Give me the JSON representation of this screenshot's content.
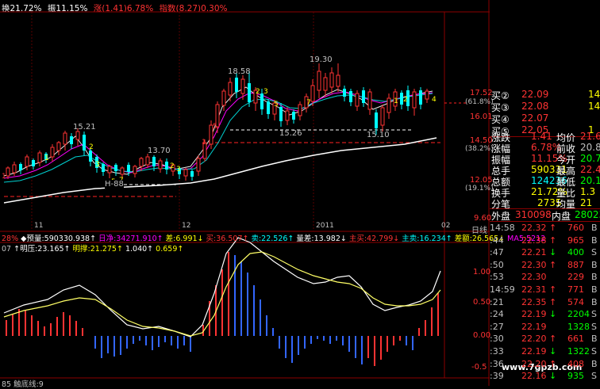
{
  "header": {
    "top_indicators": [
      {
        "text": "换21.72%",
        "color": "#ffffff"
      },
      {
        "text": "振11.15%",
        "color": "#ffffff"
      },
      {
        "text": "涨(1.41)6.78%",
        "color": "#ff3333"
      },
      {
        "text": "指数(8.27)0.30%",
        "color": "#ff3333"
      }
    ]
  },
  "price_chart": {
    "labels": [
      "15.21",
      "13.70",
      "18.58",
      "19.30",
      "15.26",
      "15.10",
      "H-88"
    ],
    "y_axis": [
      "17.52",
      "(61.8%)",
      "16.01",
      "14.50",
      "(38.2%)",
      "12.05",
      "(19.1%)",
      "9.60"
    ],
    "x_axis": [
      "11",
      "12",
      "2011",
      "02"
    ],
    "period_label": "日线"
  },
  "indicator_bar": [
    {
      "text": "28%",
      "color": "#ff3333"
    },
    {
      "text": "◆预量:590330.938↑",
      "color": "#ffffff"
    },
    {
      "text": "日净:34271.910↑",
      "color": "#ff00ff"
    },
    {
      "text": "差:6.991↓",
      "color": "#ffff00"
    },
    {
      "text": "买:36.507↑",
      "color": "#ff3333"
    },
    {
      "text": "卖:22.526↑",
      "color": "#00ffff"
    },
    {
      "text": "量差:13.982↓",
      "color": "#ffffff"
    },
    {
      "text": "主买:42.799↓",
      "color": "#ff3333"
    },
    {
      "text": "主卖:16.234↑",
      "color": "#00ffff"
    },
    {
      "text": "差额:26.565↓",
      "color": "#ffff00"
    },
    {
      "text": "MA5:5212",
      "color": "#ff00ff"
    }
  ],
  "indicator2_bar": [
    {
      "text": "07",
      "color": "#c0c0c0"
    },
    {
      "text": "↑明压:23.165↑",
      "color": "#ffffff"
    },
    {
      "text": "明撑:21.275↑",
      "color": "#ffff00"
    },
    {
      "text": "1.040↑",
      "color": "#ffffff"
    },
    {
      "text": "0.659↑",
      "color": "#ffff00"
    }
  ],
  "indicator_axis": [
    "1.00",
    "0.50",
    "0.00",
    "-0.5"
  ],
  "bottom_label": "85 触底线:9",
  "watermark": "www.7gpzb.com",
  "quote_panel": {
    "bids": [
      {
        "label": "买②",
        "price": "22.09",
        "vol": "14"
      },
      {
        "label": "买③",
        "price": "22.08",
        "vol": "14"
      },
      {
        "label": "买④",
        "price": "22.07",
        "vol": ""
      },
      {
        "label": "买⑤",
        "price": "22.05",
        "vol": "1"
      }
    ],
    "stats": [
      {
        "l1": "涨跌",
        "v1": "1.41",
        "l2": "均价",
        "v2": "21.6"
      },
      {
        "l1": "涨幅",
        "v1": "6.78%",
        "l2": "前收",
        "v2": "20.8"
      },
      {
        "l1": "振幅",
        "v1": "11.15%",
        "l2": "今开",
        "v2": "20.7"
      },
      {
        "l1": "总手",
        "v1": "590331",
        "l2": "最高",
        "v2": "22.4"
      },
      {
        "l1": "总额",
        "v1": "124236",
        "l2": "最低",
        "v2": "20.1"
      },
      {
        "l1": "换手",
        "v1": "21.72%",
        "l2": "量比",
        "v2": "1.3"
      },
      {
        "l1": "分笔",
        "v1": "2735",
        "l2": "均量",
        "v2": "21"
      }
    ],
    "outer_inner": {
      "outer_label": "外盘",
      "outer": "310098",
      "inner_label": "内盘",
      "inner": "28023"
    },
    "trades": [
      {
        "time": "14:58",
        "price": "22.32",
        "arrow": "↑",
        "vol": "760",
        "bs": "B"
      },
      {
        "time": ":44",
        "price": "22.38",
        "arrow": "↑",
        "vol": "965",
        "bs": "B"
      },
      {
        "time": ":47",
        "price": "22.21",
        "arrow": "↓",
        "vol": "400",
        "bs": "S"
      },
      {
        "time": ":50",
        "price": "22.30",
        "arrow": "↑",
        "vol": "887",
        "bs": "B"
      },
      {
        "time": ":53",
        "price": "22.30",
        "arrow": "",
        "vol": "229",
        "bs": "B"
      },
      {
        "time": "14:59",
        "price": "22.31",
        "arrow": "↑",
        "vol": "771",
        "bs": "B"
      },
      {
        "time": ":21",
        "price": "22.35",
        "arrow": "↑",
        "vol": "574",
        "bs": "B"
      },
      {
        "time": ":24",
        "price": "22.19",
        "arrow": "↓",
        "vol": "2204",
        "bs": "S"
      },
      {
        "time": ":27",
        "price": "22.19",
        "arrow": "",
        "vol": "1328",
        "bs": "S"
      },
      {
        "time": ":30",
        "price": "22.20",
        "arrow": "↑",
        "vol": "661",
        "bs": "B"
      },
      {
        "time": ":33",
        "price": "22.19",
        "arrow": "↓",
        "vol": "1322",
        "bs": "S"
      },
      {
        "time": ":36",
        "price": "22.20",
        "arrow": "↑",
        "vol": "408",
        "bs": "B"
      },
      {
        "time": ":39",
        "price": "22.16",
        "arrow": "↓",
        "vol": "935",
        "bs": "S"
      }
    ]
  }
}
